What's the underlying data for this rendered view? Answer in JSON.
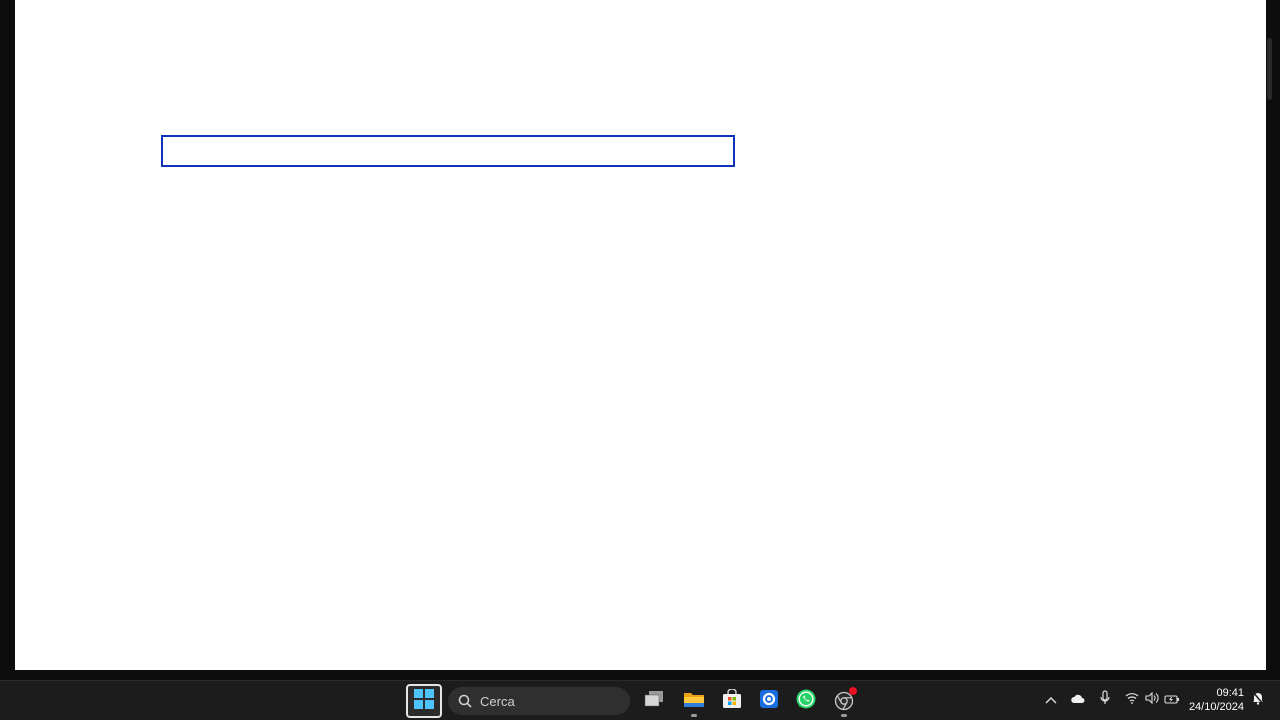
{
  "window": {
    "input_value": ""
  },
  "taskbar": {
    "search_placeholder": "Cerca",
    "pinned": [
      {
        "name": "task-view-icon"
      },
      {
        "name": "file-explorer-icon"
      },
      {
        "name": "microsoft-store-icon"
      },
      {
        "name": "settings-app-icon"
      },
      {
        "name": "whatsapp-icon"
      },
      {
        "name": "chrome-icon"
      }
    ],
    "tray": [
      "chevron-up-icon",
      "onedrive-cloud-icon",
      "microphone-icon",
      "wifi-icon",
      "volume-icon",
      "battery-icon",
      "notification-bell-icon"
    ]
  },
  "clock": {
    "time": "09:41",
    "date": "24/10/2024"
  },
  "colors": {
    "input_border": "#1133bb",
    "taskbar_bg": "#1c1c1c",
    "whatsapp": "#25d366",
    "notification_badge": "#e81123"
  }
}
